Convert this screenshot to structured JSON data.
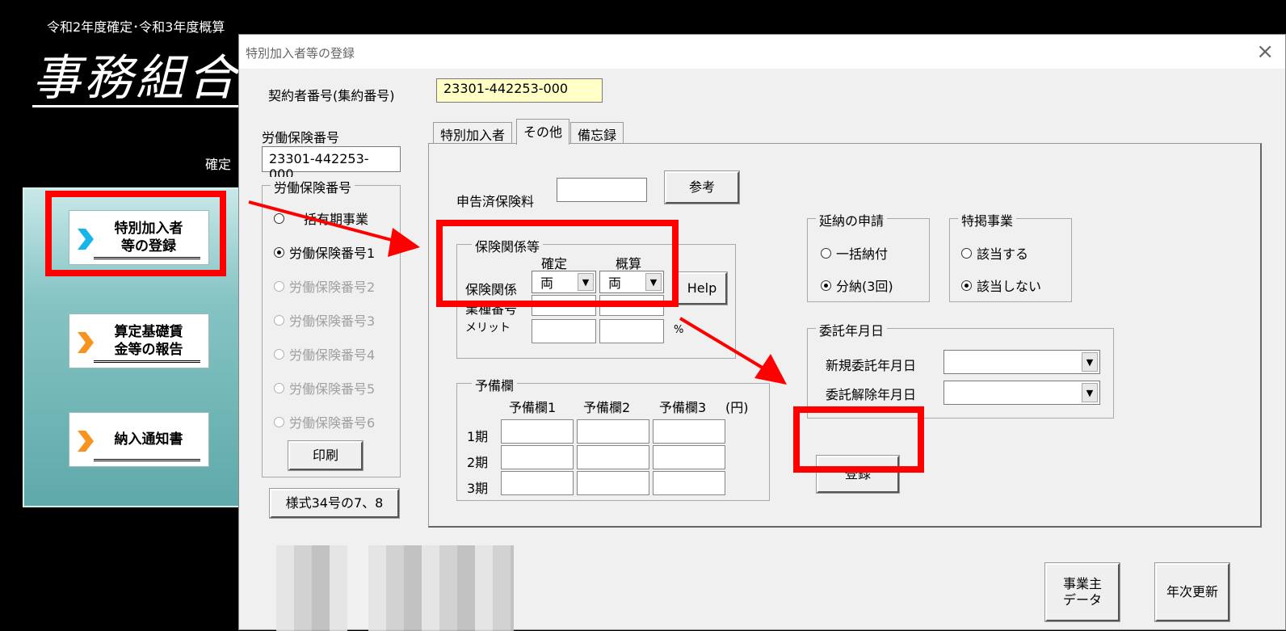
{
  "background_app": {
    "header": "令和2年度確定･令和3年度概算",
    "title": "事務組合",
    "kakutei_label": "確定",
    "menu": [
      {
        "label_line1": "特別加入者",
        "label_line2": "等の登録",
        "icon": "chevron-right-icon",
        "icon_color": "#19b5e8"
      },
      {
        "label_line1": "算定基礎賃",
        "label_line2": "金等の報告",
        "icon": "chevron-right-icon",
        "icon_color": "#f7931e"
      },
      {
        "label_line1": "納入通知書",
        "label_line2": "",
        "icon": "chevron-right-icon",
        "icon_color": "#f7931e"
      }
    ]
  },
  "dialog": {
    "title": "特別加入者等の登録",
    "close_icon": "×",
    "contract_label": "契約者番号(集約番号)",
    "contract_value": "23301-442253-000",
    "labor_label": "労働保険番号",
    "labor_value": "23301-442253-000",
    "left_group": {
      "title": "労働保険番号",
      "options": [
        {
          "label": "括有期事業",
          "checked": false,
          "disabled": false
        },
        {
          "label": "労働保険番号1",
          "checked": true,
          "disabled": false
        },
        {
          "label": "労働保険番号2",
          "checked": false,
          "disabled": true
        },
        {
          "label": "労働保険番号3",
          "checked": false,
          "disabled": true
        },
        {
          "label": "労働保険番号4",
          "checked": false,
          "disabled": true
        },
        {
          "label": "労働保険番号5",
          "checked": false,
          "disabled": true
        },
        {
          "label": "労働保険番号6",
          "checked": false,
          "disabled": true
        }
      ],
      "print_button": "印刷"
    },
    "format_button": "様式34号の7、8",
    "tabs": [
      "特別加入者",
      "その他",
      "備忘録"
    ],
    "active_tab": "その他",
    "declared_label": "申告済保険料",
    "declared_value": "",
    "reference_button": "参考",
    "hoken_group": {
      "title": "保険関係等",
      "col_kakutei": "確定",
      "col_gaisan": "概算",
      "row_kankei": "保険関係",
      "row_gyoshu": "業種番号",
      "row_merit": "メリット",
      "kakutei_value": "両",
      "gaisan_value": "両",
      "percent": "%",
      "help_button": "Help"
    },
    "yobi_group": {
      "title": "予備欄",
      "cols": [
        "予備欄1",
        "予備欄2",
        "予備欄3"
      ],
      "unit": "(円)",
      "rows": [
        "1期",
        "2期",
        "3期"
      ]
    },
    "ennou_group": {
      "title": "延納の申請",
      "options": [
        {
          "label": "一括納付",
          "checked": false
        },
        {
          "label": "分納(3回)",
          "checked": true
        }
      ]
    },
    "tokkei_group": {
      "title": "特掲事業",
      "options": [
        {
          "label": "該当する",
          "checked": false
        },
        {
          "label": "該当しない",
          "checked": true
        }
      ]
    },
    "itaku_group": {
      "title": "委託年月日",
      "new_label": "新規委託年月日",
      "cancel_label": "委託解除年月日",
      "new_value": "",
      "cancel_value": ""
    },
    "register_button": "登録",
    "employer_button_line1": "事業主",
    "employer_button_line2": "データ",
    "annual_button": "年次更新"
  },
  "annotation_color": "#ff0000"
}
